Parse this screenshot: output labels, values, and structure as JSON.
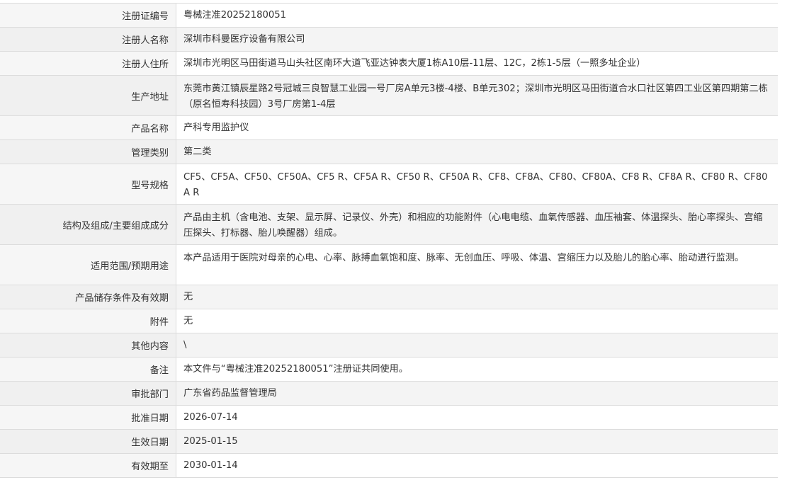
{
  "rows": [
    {
      "label": "注册证编号",
      "value": "粤械注准20252180051"
    },
    {
      "label": "注册人名称",
      "value": "深圳市科曼医疗设备有限公司"
    },
    {
      "label": "注册人住所",
      "value": "深圳市光明区马田街道马山头社区南环大道飞亚达钟表大厦1栋A10层-11层、12C，2栋1-5层（一照多址企业）"
    },
    {
      "label": "生产地址",
      "value": "东莞市黄江镇辰星路2号冠城三良智慧工业园一号厂房A单元3楼-4楼、B单元302；深圳市光明区马田街道合水口社区第四工业区第四期第二栋（原名恒寿科技园）3号厂房第1-4层"
    },
    {
      "label": "产品名称",
      "value": "产科专用监护仪"
    },
    {
      "label": "管理类别",
      "value": "第二类"
    },
    {
      "label": "型号规格",
      "value": "CF5、CF5A、CF50、CF50A、CF5 R、CF5A R、CF50 R、CF50A R、CF8、CF8A、CF80、CF80A、CF8 R、CF8A R、CF80 R、CF80A R"
    },
    {
      "label": "结构及组成/主要组成成分",
      "value": "产品由主机（含电池、支架、显示屏、记录仪、外壳）和相应的功能附件（心电电缆、血氧传感器、血压袖套、体温探头、胎心率探头、宫缩压探头、打标器、胎儿唤醒器）组成。"
    },
    {
      "label": "适用范围/预期用途",
      "value": "本产品适用于医院对母亲的心电、心率、脉搏血氧饱和度、脉率、无创血压、呼吸、体温、宫缩压力以及胎儿的胎心率、胎动进行监测。"
    },
    {
      "label": "产品储存条件及有效期",
      "value": "无"
    },
    {
      "label": "附件",
      "value": "无"
    },
    {
      "label": "其他内容",
      "value": "\\"
    },
    {
      "label": "备注",
      "value": "本文件与“粤械注准20252180051”注册证共同使用。"
    },
    {
      "label": "审批部门",
      "value": "广东省药品监督管理局"
    },
    {
      "label": "批准日期",
      "value": "2026-07-14"
    },
    {
      "label": "生效日期",
      "value": "2025-01-15"
    },
    {
      "label": "有效期至",
      "value": "2030-01-14"
    }
  ]
}
